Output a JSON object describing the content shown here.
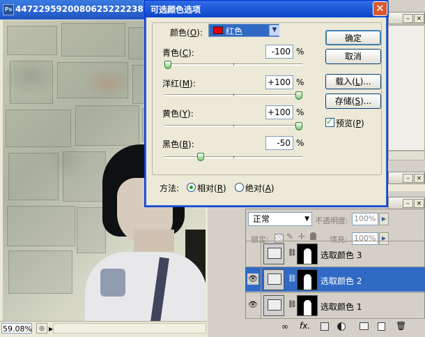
{
  "document": {
    "app_badge": "Ps",
    "title": "4472295920080625222238",
    "zoom": "59.08%"
  },
  "dialog": {
    "title": "可选颜色选项",
    "colors_label": "颜色(",
    "colors_key": "O",
    "colors_label_end": "):",
    "colors_value": "红色",
    "sliders": [
      {
        "label": "青色(",
        "key": "C",
        "end": "):",
        "value": "-100",
        "unit": "%",
        "fraction": 0.0
      },
      {
        "label": "洋红(",
        "key": "M",
        "end": "):",
        "value": "+100",
        "unit": "%",
        "fraction": 1.0
      },
      {
        "label": "黄色(",
        "key": "Y",
        "end": "):",
        "value": "+100",
        "unit": "%",
        "fraction": 1.0
      },
      {
        "label": "黑色(",
        "key": "B",
        "end": "):",
        "value": "-50",
        "unit": "%",
        "fraction": 0.25
      }
    ],
    "method_label": "方法:",
    "method_relative": "相对(",
    "method_relative_key": "R",
    "method_absolute": "绝对(",
    "method_absolute_key": "A",
    "paren_close": ")",
    "buttons": {
      "ok": "确定",
      "cancel": "取消",
      "load_pre": "载入(",
      "load_key": "L",
      "load_post": ")...",
      "save_pre": "存储(",
      "save_key": "S",
      "save_post": ")..."
    },
    "preview_pre": "预览(",
    "preview_key": "P",
    "preview_checked": true
  },
  "layers": {
    "blend_mode": "正常",
    "opacity_label": "不透明度:",
    "opacity_value": "100%",
    "lock_label": "锁定:",
    "fill_label": "填充:",
    "fill_value": "100%",
    "items": [
      {
        "name": "选取颜色 3",
        "visible": false,
        "selected": false
      },
      {
        "name": "选取颜色 2",
        "visible": true,
        "selected": true
      },
      {
        "name": "选取颜色 1",
        "visible": true,
        "selected": false
      }
    ],
    "footer_icons": [
      "link-icon",
      "fx-icon",
      "mask-icon",
      "adjustment-icon",
      "folder-icon",
      "new-layer-icon",
      "trash-icon"
    ]
  }
}
